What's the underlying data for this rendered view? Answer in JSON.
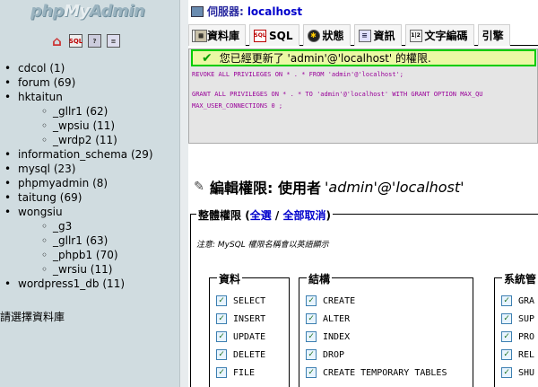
{
  "logo": {
    "php": "php",
    "my": "My",
    "admin": "Admin"
  },
  "nav_icons": [
    "home-icon",
    "sql-icon",
    "query-window-icon",
    "docs-icon"
  ],
  "databases": [
    {
      "name": "cdcol",
      "count": "(1)"
    },
    {
      "name": "forum",
      "count": "(69)"
    },
    {
      "name": "hktaitun",
      "count": "",
      "tables": [
        {
          "name": "_gllr1",
          "count": "(62)"
        },
        {
          "name": "_wpsiu",
          "count": "(11)"
        },
        {
          "name": "_wrdp2",
          "count": "(11)"
        }
      ]
    },
    {
      "name": "information_schema",
      "count": "(29)"
    },
    {
      "name": "mysql",
      "count": "(23)"
    },
    {
      "name": "phpmyadmin",
      "count": "(8)"
    },
    {
      "name": "taitung",
      "count": "(69)"
    },
    {
      "name": "wongsiu",
      "count": "",
      "tables": [
        {
          "name": "_g3",
          "count": ""
        },
        {
          "name": "_gllr1",
          "count": "(63)"
        },
        {
          "name": "_phpb1",
          "count": "(70)"
        },
        {
          "name": "_wrsiu",
          "count": "(11)"
        }
      ]
    },
    {
      "name": "wordpress1_db",
      "count": "(11)"
    }
  ],
  "choose_db": "請選擇資料庫",
  "server": {
    "label": "伺服器:",
    "value": "localhost"
  },
  "tabs": [
    {
      "label": "資料庫",
      "icon": "database-icon"
    },
    {
      "label": "SQL",
      "icon": "sql-icon"
    },
    {
      "label": "狀態",
      "icon": "status-icon"
    },
    {
      "label": "資訊",
      "icon": "info-icon"
    },
    {
      "label": "文字編碼",
      "icon": "charset-icon"
    },
    {
      "label": "引擎",
      "icon": "engine-icon"
    }
  ],
  "message": "您已經更新了 'admin'@'localhost' 的權限.",
  "sql": {
    "line1": "REVOKE ALL PRIVILEGES ON * . * FROM 'admin'@'localhost';",
    "line2": "GRANT ALL PRIVILEGES ON * . * TO 'admin'@'localhost' WITH GRANT OPTION MAX_QU",
    "line3": "MAX_USER_CONNECTIONS 0 ;"
  },
  "edit_title": {
    "prefix": "編輯權限: 使用者",
    "user": "'admin'@'localhost'"
  },
  "global": {
    "title": "整體權限",
    "open_paren": "(",
    "select_all": "全選",
    "separator": "/",
    "deselect_all": "全部取消",
    "close_paren": ")",
    "note": "注意: MySQL 權限名稱會以英語顯示"
  },
  "groups": {
    "data": {
      "title": "資料",
      "privs": [
        "SELECT",
        "INSERT",
        "UPDATE",
        "DELETE",
        "FILE"
      ]
    },
    "structure": {
      "title": "結構",
      "privs": [
        "CREATE",
        "ALTER",
        "INDEX",
        "DROP",
        "CREATE TEMPORARY TABLES"
      ]
    },
    "admin": {
      "title": "系統管",
      "privs": [
        "GRA",
        "SUP",
        "PRO",
        "REL",
        "SHU"
      ]
    }
  },
  "colors": {
    "nav_bg": "#d0dce0",
    "success_border": "#00cc00",
    "success_bg": "#ebf8a4",
    "sql_keyword": "#990099",
    "sql_string": "#008000"
  }
}
